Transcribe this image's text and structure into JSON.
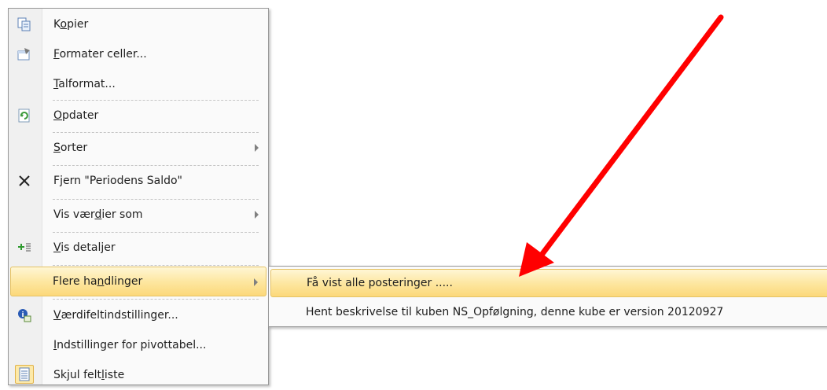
{
  "context_menu": {
    "items": [
      {
        "pre": "K",
        "ul": "o",
        "post": "pier",
        "icon": "copy-icon"
      },
      {
        "pre": "",
        "ul": "F",
        "post": "ormater celler...",
        "icon": "format-cells-icon"
      },
      {
        "pre": "",
        "ul": "T",
        "post": "alformat...",
        "icon": ""
      },
      {
        "pre": "",
        "ul": "O",
        "post": "pdater",
        "icon": "refresh-icon"
      },
      {
        "pre": "",
        "ul": "S",
        "post": "orter",
        "icon": ""
      },
      {
        "pre": "F",
        "ul": "j",
        "post": "ern \"Periodens Saldo\"",
        "icon": "remove-x-icon"
      },
      {
        "pre": "Vis vær",
        "ul": "d",
        "post": "ier som",
        "icon": ""
      },
      {
        "pre": "",
        "ul": "V",
        "post": "is detaljer",
        "icon": "show-details-icon"
      },
      {
        "pre": "Flere ha",
        "ul": "n",
        "post": "dlinger",
        "icon": ""
      },
      {
        "pre": "",
        "ul": "V",
        "post": "ærdifeltindstillinger...",
        "icon": "field-settings-icon"
      },
      {
        "pre": "",
        "ul": "I",
        "post": "ndstillinger for pivottabel...",
        "icon": ""
      },
      {
        "pre": "Skjul felt",
        "ul": "l",
        "post": "iste",
        "icon": "field-list-icon"
      }
    ]
  },
  "submenu": {
    "items": [
      {
        "label": "Få vist alle posteringer ....."
      },
      {
        "label": "Hent beskrivelse til kuben NS_Opfølgning, denne kube er version 20120927"
      }
    ]
  },
  "colors": {
    "highlight": "#fcd87a",
    "annotation_arrow": "#ff0000"
  }
}
